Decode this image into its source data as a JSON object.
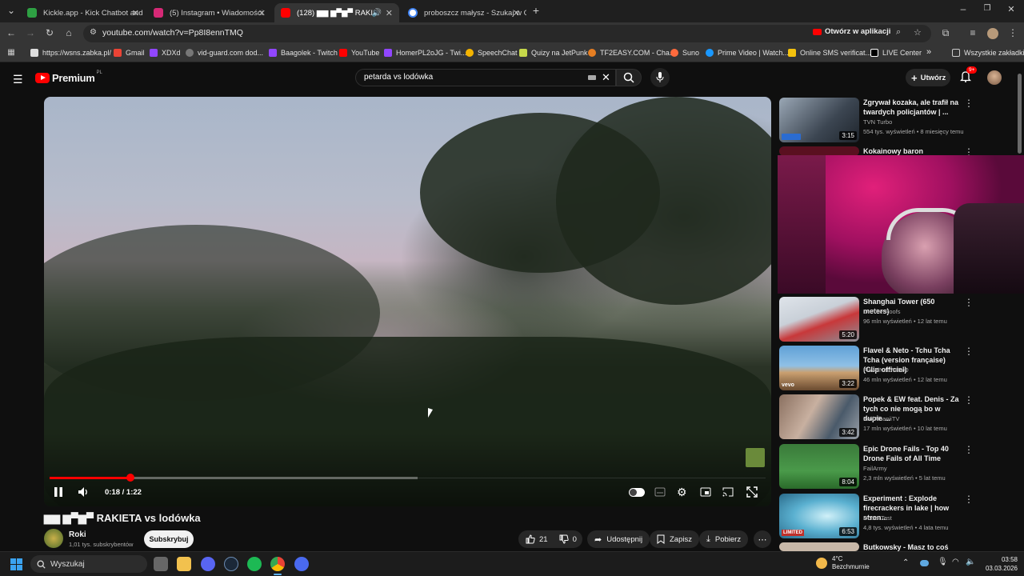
{
  "browser": {
    "tabs": [
      {
        "title": "Kickle.app - Kick Chatbot and",
        "color": "#2ea043"
      },
      {
        "title": "(5) Instagram • Wiadomości",
        "color": "#d62976"
      },
      {
        "title": "(128) ▆▆ ▆▀▆▀ RAKI",
        "color": "#ff0000"
      },
      {
        "title": "proboszcz małysz - Szukaj w Go",
        "color": "#4285f4"
      }
    ],
    "url": "youtube.com/watch?v=Pp8I8ennTMQ",
    "open_in_app": "Otwórz w aplikacji",
    "bookmarks": [
      "https://wsns.zabka.pl/",
      "Gmail",
      "XDXd",
      "vid-guard.com dod...",
      "Baagolek - Twitch",
      "YouTube",
      "HomerPL2oJG - Twi...",
      "SpeechChat",
      "Quizy na JetPunk",
      "TF2EASY.COM - Cha...",
      "Suno",
      "Prime Video | Watch...",
      "Online SMS verificat...",
      "LIVE Center"
    ],
    "all_bookmarks": "Wszystkie zakładki"
  },
  "youtube": {
    "logo": "Premium",
    "logo_region": "PL",
    "search_value": "petarda vs lodówka",
    "create_label": "Utwórz",
    "notif_count": "9+"
  },
  "player": {
    "progress_fraction": 0.22,
    "time": "0:18 / 1:22"
  },
  "video": {
    "title": "▆▆ ▆▀▆▀ RAKIETA vs lodówka",
    "channel": "Roki",
    "subscribers": "1,01 tys. subskrybentów",
    "subscribe": "Subskrybuj",
    "likes": "21",
    "dislikes": "0",
    "share": "Udostępnij",
    "save": "Zapisz",
    "download": "Pobierz"
  },
  "recommendations": [
    {
      "title": "Zgrywał kozaka, ale trafił na twardych policjantów | ...",
      "channel": "TVN Turbo",
      "meta": "554 tys. wyświetleń • 8 miesięcy temu",
      "duration": "3:15"
    },
    {
      "title": "Kokainowy baron",
      "channel": "",
      "meta": "",
      "duration": ""
    },
    {
      "title": "Shanghai Tower (650 meters)",
      "channel": "On The Roofs",
      "meta": "96 mln wyświetleń • 12 lat temu",
      "duration": "5:20"
    },
    {
      "title": "Flavel & Neto - Tchu Tcha Tcha (version française) (Clip officiel)",
      "channel": "FlavelNetoVEVO",
      "meta": "46 mln wyświetleń • 12 lat temu",
      "duration": "3:22"
    },
    {
      "title": "Popek & EW feat. Denis - Za tych co nie mogą bo w dupie ...",
      "channel": "KrólAlbaniiTV",
      "meta": "17 mln wyświetleń • 10 lat temu",
      "duration": "3:42"
    },
    {
      "title": "Epic Drone Fails - Top 40 Drone Fails of All Time",
      "channel": "FailArmy",
      "meta": "2,3 mln wyświetleń • 5 lat temu",
      "duration": "8:04"
    },
    {
      "title": "Experiment : Explode firecrackers in lake | how stron...",
      "channel": "DoctorTest",
      "meta": "4,8 tys. wyświetleń • 4 lata temu",
      "duration": "6:53"
    },
    {
      "title": "Butkowsky - Masz to coś",
      "channel": "",
      "meta": "",
      "duration": ""
    }
  ],
  "taskbar": {
    "search": "Wyszukaj",
    "weather_temp": "4°C",
    "weather_desc": "Bezchmurnie",
    "time": "03:58",
    "date": "03.03.2026"
  }
}
